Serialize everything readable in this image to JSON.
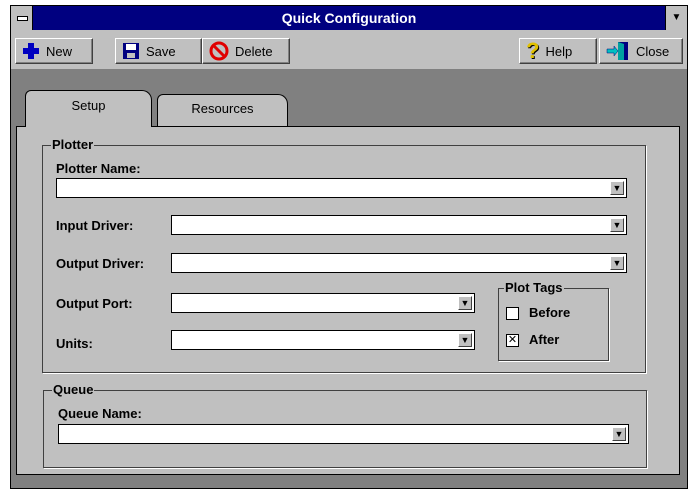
{
  "window": {
    "title": "Quick Configuration"
  },
  "toolbar": {
    "new_label": "New",
    "save_label": "Save",
    "delete_label": "Delete",
    "help_label": "Help",
    "close_label": "Close"
  },
  "tabs": [
    {
      "label": "Setup",
      "active": true
    },
    {
      "label": "Resources",
      "active": false
    }
  ],
  "plotter": {
    "group_label": "Plotter",
    "plotter_name_label": "Plotter Name:",
    "plotter_name_value": "",
    "input_driver_label": "Input Driver:",
    "input_driver_value": "",
    "output_driver_label": "Output Driver:",
    "output_driver_value": "",
    "output_port_label": "Output Port:",
    "output_port_value": "",
    "units_label": "Units:",
    "units_value": ""
  },
  "plot_tags": {
    "group_label": "Plot Tags",
    "before_label": "Before",
    "before_checked": false,
    "after_label": "After",
    "after_checked": true
  },
  "queue": {
    "group_label": "Queue",
    "queue_name_label": "Queue Name:",
    "queue_name_value": ""
  },
  "colors": {
    "titlebar": "#000080",
    "face": "#c0c0c0",
    "client_bg": "#808080"
  }
}
